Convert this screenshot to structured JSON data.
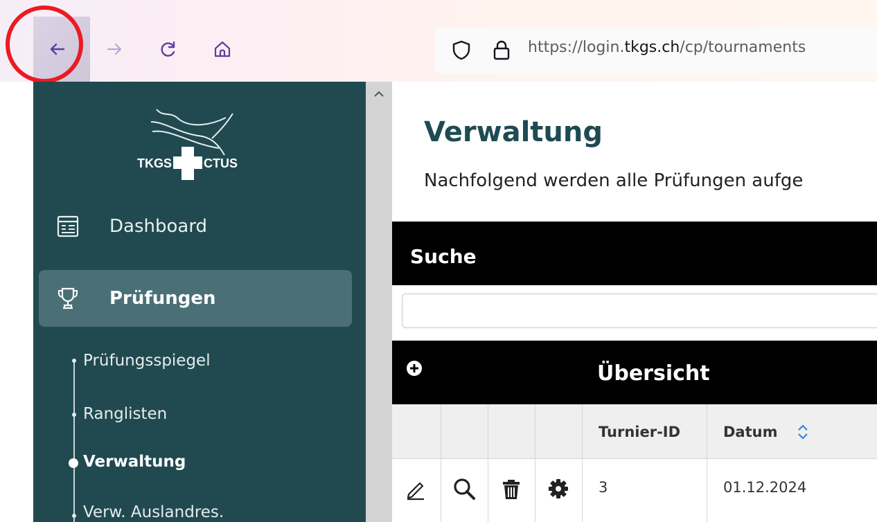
{
  "browser": {
    "url_prefix": "https://login.",
    "url_domain": "tkgs.ch",
    "url_path": "/cp/tournaments",
    "icons": [
      "back-arrow-icon",
      "forward-arrow-icon",
      "reload-icon",
      "home-icon",
      "shield-icon",
      "lock-icon"
    ]
  },
  "sidebar": {
    "logo_text_left": "TKGS",
    "logo_text_right": "CTUS",
    "items": [
      {
        "label": "Dashboard",
        "icon": "dashboard-icon"
      },
      {
        "label": "Prüfungen",
        "icon": "trophy-icon",
        "active": true
      }
    ],
    "subitems": [
      {
        "label": "Prüfungsspiegel"
      },
      {
        "label": "Ranglisten"
      },
      {
        "label": "Verwaltung",
        "active": true
      },
      {
        "label": "Verw. Auslandres."
      }
    ]
  },
  "main": {
    "title": "Verwaltung",
    "subtitle": "Nachfolgend werden alle Prüfungen aufge",
    "search_title": "Suche",
    "search_placeholder": "",
    "overview_title": "Übersicht",
    "table": {
      "columns": [
        "",
        "",
        "",
        "",
        "Turnier-ID",
        "Datum"
      ],
      "rows": [
        {
          "actions": [
            "edit-icon",
            "view-icon",
            "delete-icon",
            "settings-icon"
          ],
          "turnier_id": "3",
          "datum": "01.12.2024"
        }
      ]
    }
  },
  "colors": {
    "sidebar_bg": "#214a50",
    "sidebar_active": "#4a7076",
    "title_color": "#1e4b52",
    "highlight_ring": "#ea1b22"
  }
}
